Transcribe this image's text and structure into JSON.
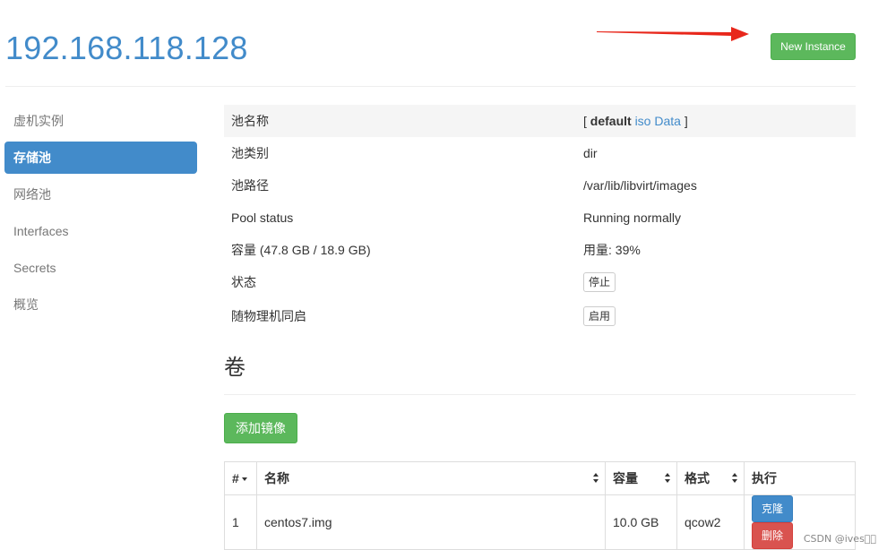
{
  "page": {
    "host": "192.168.118.128",
    "new_instance_label": "New Instance"
  },
  "sidebar": {
    "items": [
      {
        "label": "虚机实例",
        "active": false
      },
      {
        "label": "存储池",
        "active": true
      },
      {
        "label": "网络池",
        "active": false
      },
      {
        "label": "Interfaces",
        "active": false
      },
      {
        "label": "Secrets",
        "active": false
      },
      {
        "label": "概览",
        "active": false
      }
    ]
  },
  "pool_info": {
    "name_label": "池名称",
    "name_prefix": "[",
    "name_current": "default",
    "name_links": [
      "iso",
      "Data"
    ],
    "name_suffix": "]",
    "type_label": "池类别",
    "type_value": "dir",
    "path_label": "池路径",
    "path_value": "/var/lib/libvirt/images",
    "status_label": "Pool status",
    "status_value": "Running normally",
    "capacity_label": "容量 (47.8 GB / 18.9 GB)",
    "usage_value": "用量: 39%",
    "state_label": "状态",
    "stop_button": "停止",
    "autostart_label": "随物理机同启",
    "enable_button": "启用"
  },
  "volumes": {
    "title": "卷",
    "add_button": "添加镜像",
    "columns": [
      "#",
      "名称",
      "容量",
      "格式",
      "执行"
    ],
    "rows": [
      {
        "index": "1",
        "name": "centos7.img",
        "size": "10.0 GB",
        "format": "qcow2",
        "clone_label": "克隆",
        "delete_label": "删除"
      }
    ]
  },
  "watermark": "CSDN @ives⃞⃞",
  "colors": {
    "accent": "#428bca",
    "success": "#5cb85c",
    "danger": "#d9534f",
    "arrow": "#e8271b"
  }
}
